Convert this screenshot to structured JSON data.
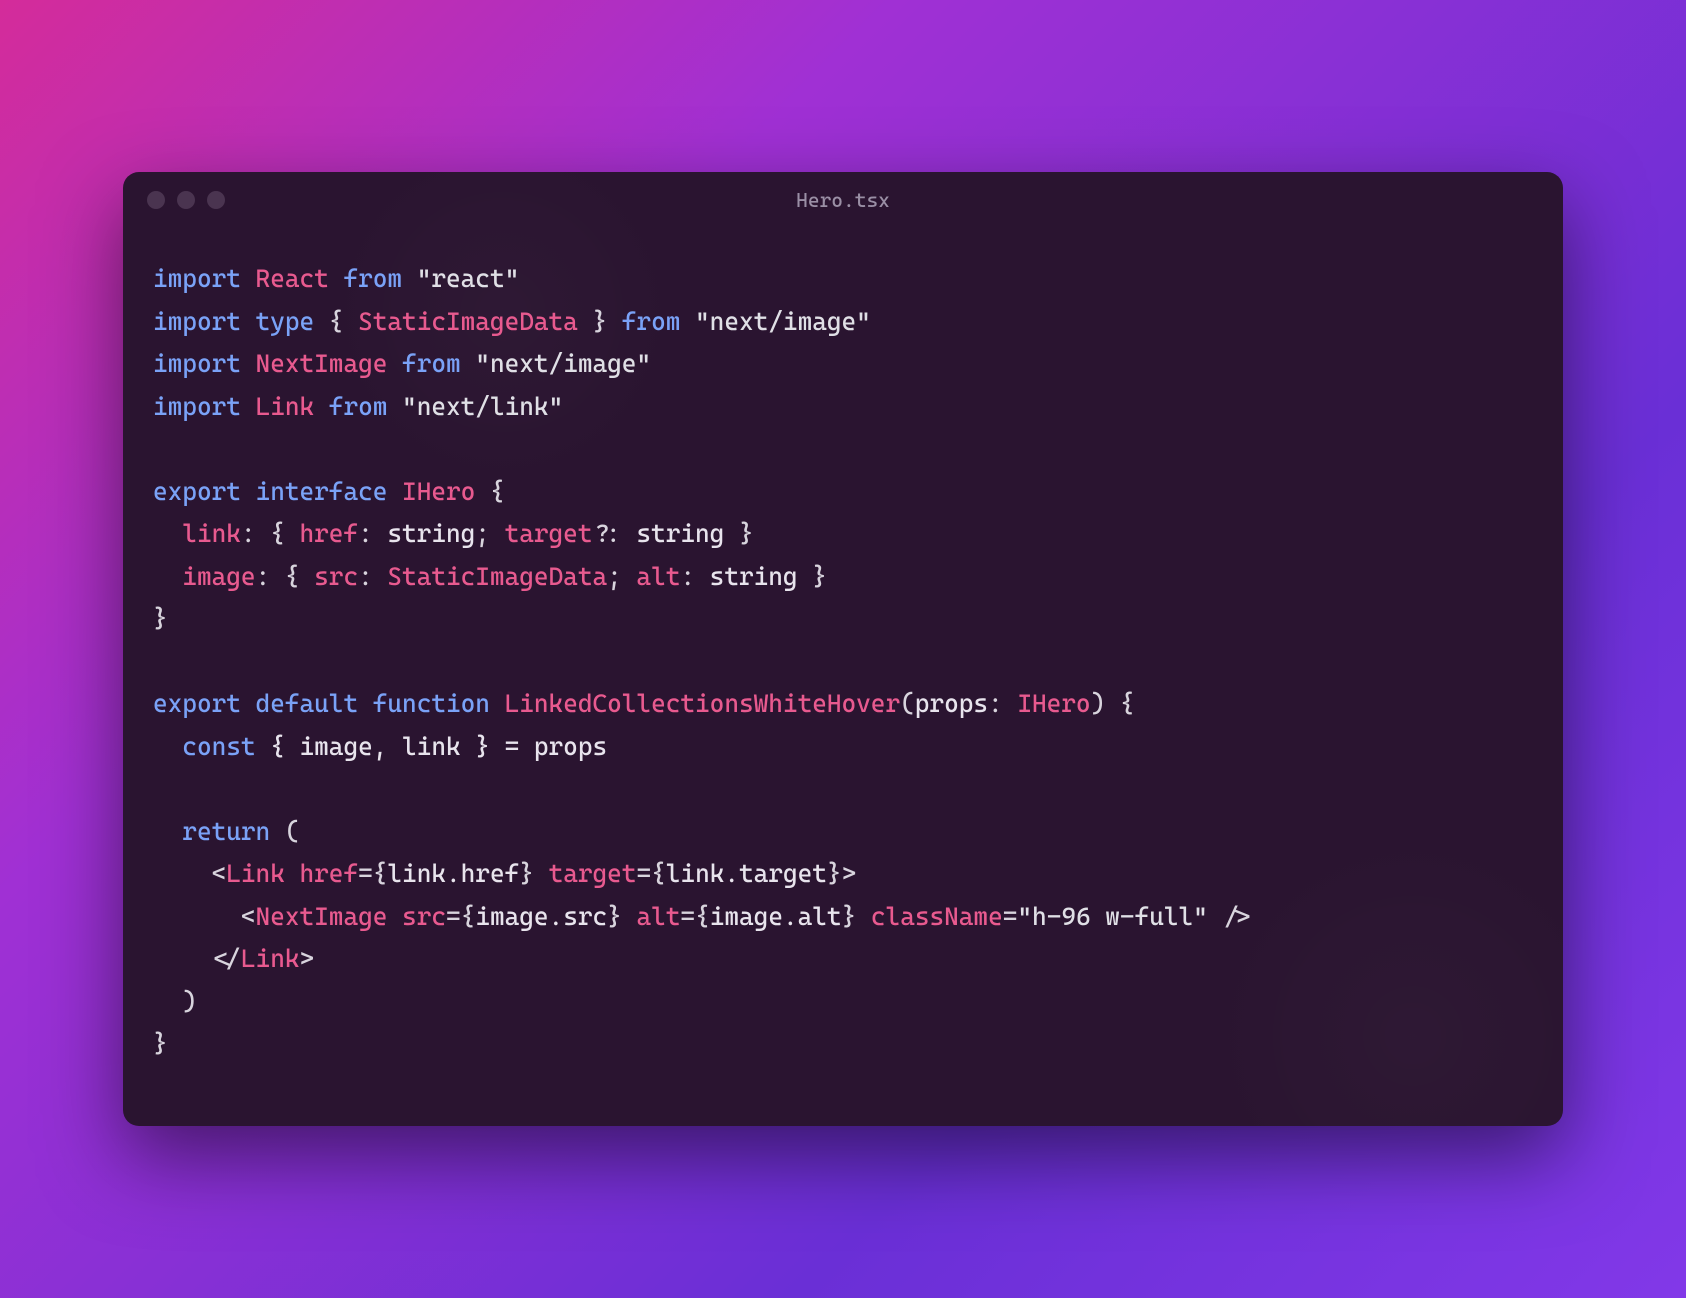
{
  "window": {
    "title": "Hero.tsx"
  },
  "code": {
    "line1": {
      "import": "import",
      "name": "React",
      "from": "from",
      "path": "\"react\""
    },
    "line2": {
      "import": "import",
      "type": "type",
      "braceOpen": "{ ",
      "name": "StaticImageData",
      "braceClose": " }",
      "from": "from",
      "path": "\"next/image\""
    },
    "line3": {
      "import": "import",
      "name": "NextImage",
      "from": "from",
      "path": "\"next/image\""
    },
    "line4": {
      "import": "import",
      "name": "Link",
      "from": "from",
      "path": "\"next/link\""
    },
    "line6": {
      "export": "export",
      "interface": "interface",
      "name": "IHero",
      "brace": " {"
    },
    "line7": {
      "indent": "  ",
      "prop1": "link",
      "colon1": ": { ",
      "prop2": "href",
      "colon2": ": ",
      "type1": "string",
      "semi1": "; ",
      "prop3": "target",
      "opt": "?",
      "colon3": ": ",
      "type2": "string",
      "close": " }"
    },
    "line8": {
      "indent": "  ",
      "prop1": "image",
      "colon1": ": { ",
      "prop2": "src",
      "colon2": ": ",
      "type1": "StaticImageData",
      "semi1": "; ",
      "prop3": "alt",
      "colon3": ": ",
      "type2": "string",
      "close": " }"
    },
    "line9": {
      "brace": "}"
    },
    "line11": {
      "export": "export",
      "default": "default",
      "function": "function",
      "name": "LinkedCollectionsWhiteHover",
      "parenOpen": "(",
      "param": "props",
      "colon": ": ",
      "paramType": "IHero",
      "parenClose": ") {"
    },
    "line12": {
      "indent": "  ",
      "const": "const",
      "destructure": " { image, link } = props"
    },
    "line14": {
      "indent": "  ",
      "return": "return",
      "paren": " ("
    },
    "line15": {
      "indent": "    <",
      "tag": "Link",
      "sp1": " ",
      "attr1": "href",
      "eq1": "=",
      "val1o": "{",
      "val1": "link.href",
      "val1c": "}",
      "sp2": " ",
      "attr2": "target",
      "eq2": "=",
      "val2o": "{",
      "val2": "link.target",
      "val2c": "}",
      "close": ">"
    },
    "line16": {
      "indent": "      <",
      "tag": "NextImage",
      "sp1": " ",
      "attr1": "src",
      "eq1": "=",
      "val1o": "{",
      "val1": "image.src",
      "val1c": "}",
      "sp2": " ",
      "attr2": "alt",
      "eq2": "=",
      "val2o": "{",
      "val2": "image.alt",
      "val2c": "}",
      "sp3": " ",
      "attr3": "className",
      "eq3": "=",
      "val3": "\"h-96 w-full\"",
      "close": " />"
    },
    "line17": {
      "indent": "    </",
      "tag": "Link",
      "close": ">"
    },
    "line18": {
      "indent": "  ",
      "paren": ")"
    },
    "line19": {
      "brace": "}"
    }
  }
}
